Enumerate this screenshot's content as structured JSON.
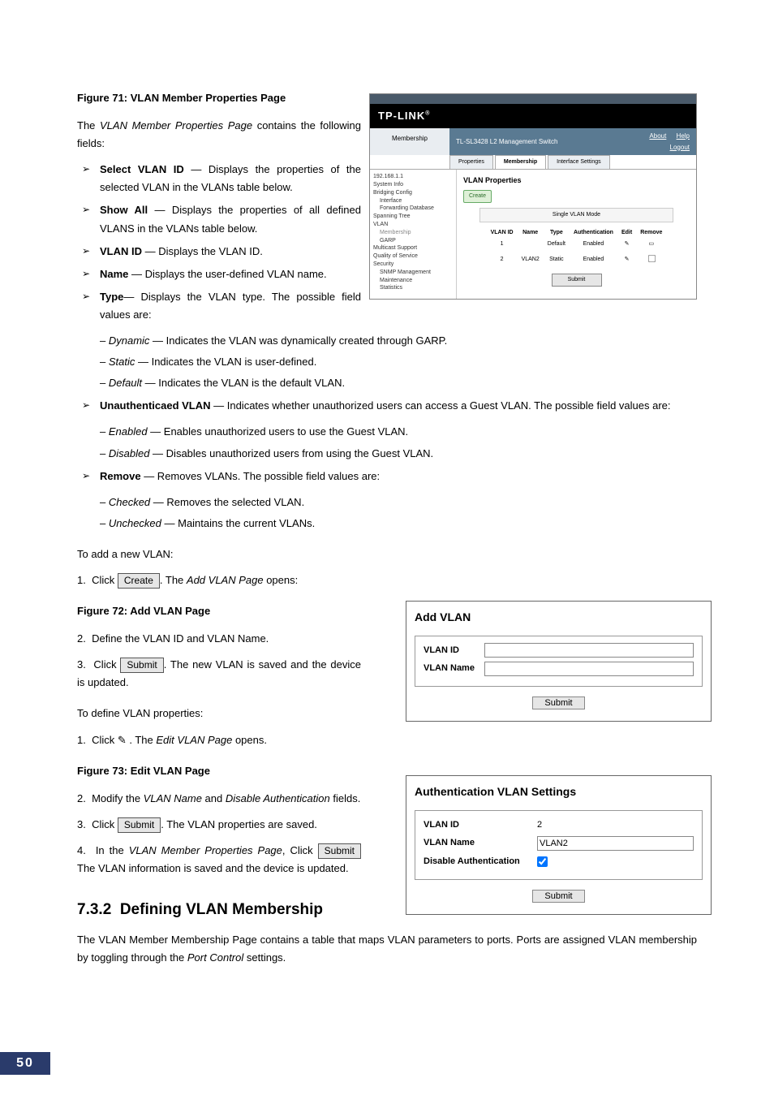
{
  "fig71": {
    "caption": "Figure 71: VLAN Member Properties Page",
    "intro": "The VLAN Member Properties Page contains the following fields:",
    "bullets": [
      {
        "term": "Select VLAN ID",
        "desc": " — Displays the properties of the selected VLAN in the VLANs table below."
      },
      {
        "term": "Show All",
        "desc": " — Displays the properties of all defined VLANS in the VLANs table below."
      },
      {
        "term": "VLAN ID",
        "desc": " — Displays the VLAN ID."
      },
      {
        "term": "Name",
        "desc": " — Displays the user-defined VLAN name."
      }
    ],
    "type": {
      "term": "Type",
      "desc": "— Displays the VLAN type. The possible field values are:",
      "subs": [
        {
          "term": "Dynamic",
          "desc": " — Indicates the VLAN was dynamically created through GARP."
        },
        {
          "term": "Static",
          "desc": " — Indicates the VLAN is user-defined."
        },
        {
          "term": "Default",
          "desc": " — Indicates the VLAN is the default VLAN."
        }
      ]
    },
    "unauth": {
      "term": "Unauthenticaed VLAN",
      "desc": " — Indicates whether unauthorized users can access a Guest VLAN. The possible field values are:",
      "subs": [
        {
          "term": "Enabled",
          "desc": " — Enables unauthorized users to use the Guest VLAN."
        },
        {
          "term": "Disabled",
          "desc": " — Disables unauthorized users from using the Guest VLAN."
        }
      ]
    },
    "remove": {
      "term": "Remove",
      "desc": " — Removes VLANs. The possible field values are:",
      "subs": [
        {
          "term": "Checked",
          "desc": " — Removes the selected VLAN."
        },
        {
          "term": "Unchecked",
          "desc": " — Maintains the current VLANs."
        }
      ]
    }
  },
  "addSteps": {
    "lead": "To add a new VLAN:",
    "s1a": "Click ",
    "s1btn": "Create",
    "s1b": ". The Add VLAN Page opens:"
  },
  "fig72": {
    "caption": "Figure 72: Add VLAN Page",
    "s2": "Define the VLAN ID and VLAN Name.",
    "s3a": "Click ",
    "s3btn": "Submit",
    "s3b": ". The new VLAN is saved and the device is updated.",
    "panel": {
      "title": "Add VLAN",
      "id": "VLAN ID",
      "name": "VLAN Name",
      "submit": "Submit"
    }
  },
  "defSteps": {
    "lead": "To define VLAN properties:",
    "s1a": "Click  ",
    "s1b": " . The Edit VLAN Page opens."
  },
  "fig73": {
    "caption": "Figure 73: Edit VLAN Page",
    "s2a": "Modify the ",
    "s2v1": "VLAN Name",
    "s2mid": " and ",
    "s2v2": "Disable Authentication",
    "s2b": " fields.",
    "s3a": "Click ",
    "s3btn": "Submit",
    "s3b": ". The VLAN properties are saved.",
    "s4a": "In the ",
    "s4v": "VLAN Member Properties Page",
    "s4b": ", Click ",
    "s4btn": "Submit",
    "s4c": " The VLAN information is saved and the device is updated.",
    "panel": {
      "title": "Authentication VLAN Settings",
      "id_l": "VLAN ID",
      "id_v": "2",
      "name_l": "VLAN Name",
      "name_v": "VLAN2",
      "dis_l": "Disable Authentication",
      "submit": "Submit"
    }
  },
  "sec": {
    "num": "7.3.2",
    "title": "Defining VLAN Membership",
    "para": "The VLAN Member Membership Page contains a table that maps VLAN parameters to ports. Ports are assigned VLAN membership by toggling through the Port Control settings."
  },
  "shot71": {
    "logo": "TP-LINK",
    "sideTitle": "Membership",
    "headTitle": "TL-SL3428 L2 Management Switch",
    "about": "About",
    "help": "Help",
    "logout": "Logout",
    "tabs": [
      "Properties",
      "Membership",
      "Interface Settings"
    ],
    "tree": [
      "192.168.1.1",
      "System Info",
      "Bridging Config",
      " Interface",
      " Forwarding Database",
      "Spanning Tree",
      "VLAN",
      " Membership",
      " GARP",
      "Multicast Support",
      "Quality of Service",
      "Security",
      "SNMP Management",
      "Maintenance",
      "Statistics"
    ],
    "panelTitle": "VLAN Properties",
    "create": "Create",
    "mode": "Single VLAN Mode",
    "th": [
      "VLAN ID",
      "Name",
      "Type",
      "Authentication",
      "Edit",
      "Remove"
    ],
    "rows": [
      [
        "1",
        "",
        "Default",
        "Enabled",
        "✎",
        "▭"
      ],
      [
        "2",
        "VLAN2",
        "Static",
        "Enabled",
        "✎",
        "☐"
      ]
    ],
    "submit": "Submit"
  },
  "page": "50"
}
